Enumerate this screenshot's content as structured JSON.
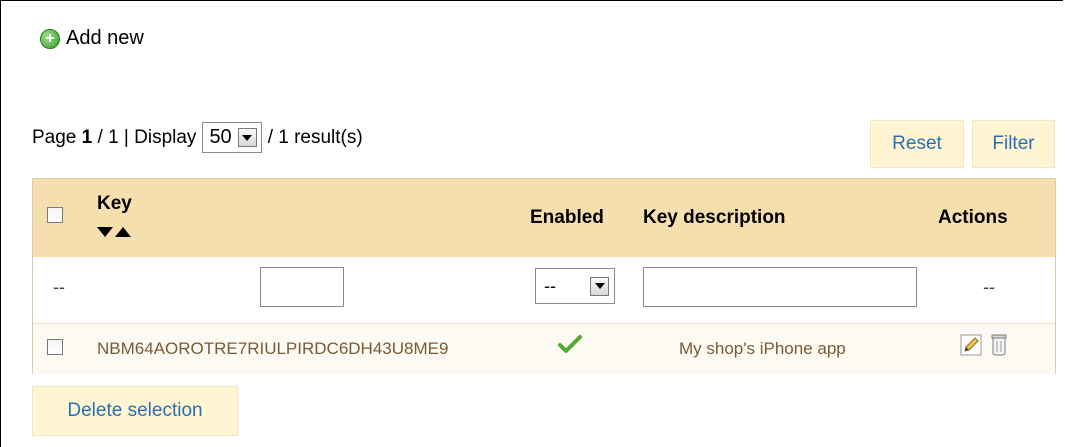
{
  "toolbar": {
    "add_new_label": "Add new",
    "add_icon": "plus-circle-icon"
  },
  "pager": {
    "page_label": "Page",
    "current_page": "1",
    "separator": "/ 1 | Display",
    "per_page": "50",
    "results_text": "/ 1 result(s)"
  },
  "actions": {
    "reset_label": "Reset",
    "filter_label": "Filter",
    "delete_selection_label": "Delete selection"
  },
  "table": {
    "columns": {
      "key": "Key",
      "enabled": "Enabled",
      "description": "Key description",
      "actions": "Actions"
    },
    "filters": {
      "id_placeholder": "--",
      "enabled_value": "--",
      "actions_placeholder": "--",
      "key_value": "",
      "description_value": ""
    },
    "rows": [
      {
        "key": "NBM64AOROTRE7RIULPIRDC6DH43U8ME9",
        "enabled": true,
        "description": "My shop's iPhone app"
      }
    ]
  },
  "colors": {
    "header_bg": "#f5dfae",
    "button_bg": "#fff5d3",
    "link_blue": "#2a6fb0",
    "row_text": "#7a5a34",
    "check_green": "#4caf2f"
  }
}
